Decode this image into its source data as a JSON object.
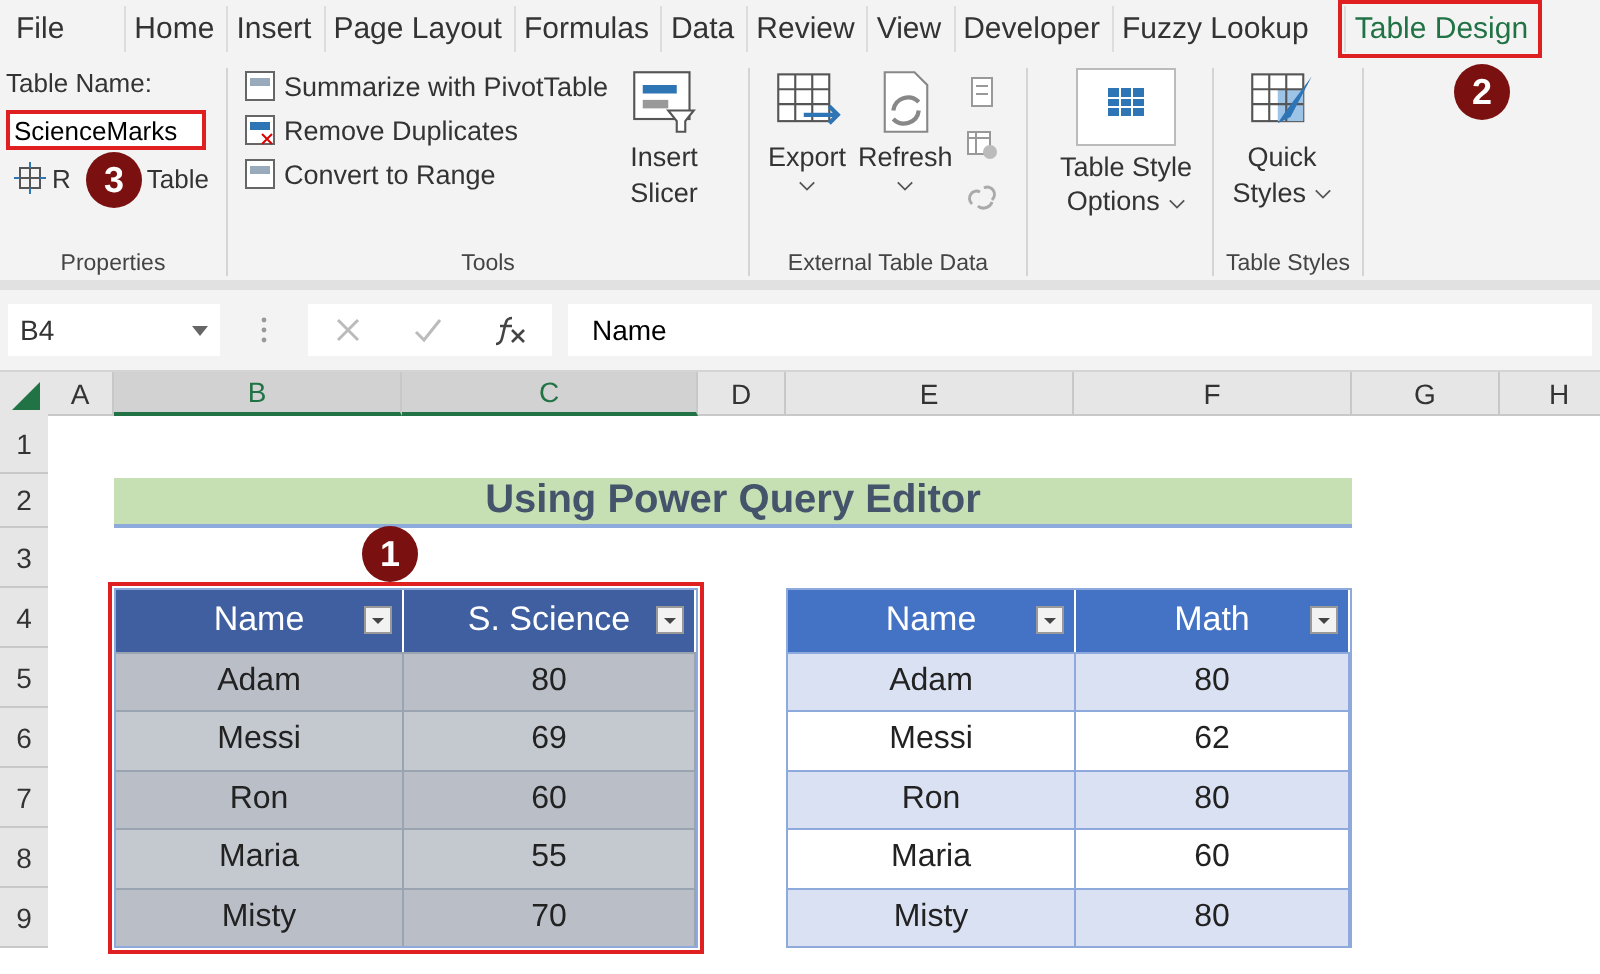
{
  "ribbon_tabs": [
    {
      "label": "File",
      "selected": false
    },
    {
      "label": "Home",
      "selected": false
    },
    {
      "label": "Insert",
      "selected": false
    },
    {
      "label": "Page Layout",
      "selected": false
    },
    {
      "label": "Formulas",
      "selected": false
    },
    {
      "label": "Data",
      "selected": false
    },
    {
      "label": "Review",
      "selected": false
    },
    {
      "label": "View",
      "selected": false
    },
    {
      "label": "Developer",
      "selected": false
    },
    {
      "label": "Fuzzy Lookup",
      "selected": false
    },
    {
      "label": "Table Design",
      "selected": true
    }
  ],
  "properties": {
    "name_label": "Table Name:",
    "name_value": "ScienceMarks",
    "resize_parts": [
      "R",
      "Table"
    ],
    "group_label": "Properties"
  },
  "tools": {
    "buttons": [
      "Summarize with PivotTable",
      "Remove Duplicates",
      "Convert to Range"
    ],
    "slicer": "Insert Slicer",
    "group_label": "Tools"
  },
  "external": {
    "buttons": [
      "Export",
      "Refresh"
    ],
    "group_label": "External Table Data"
  },
  "style_options": {
    "label": "Table Style Options"
  },
  "styles": {
    "label": "Quick Styles",
    "group_label": "Table Styles"
  },
  "callouts": [
    {
      "number": "1"
    },
    {
      "number": "2"
    },
    {
      "number": "3"
    }
  ],
  "name_box": "B4",
  "formula": "Name",
  "columns": [
    {
      "label": "A",
      "selected": false
    },
    {
      "label": "B",
      "selected": true
    },
    {
      "label": "C",
      "selected": true
    },
    {
      "label": "D",
      "selected": false
    },
    {
      "label": "E",
      "selected": false
    },
    {
      "label": "F",
      "selected": false
    },
    {
      "label": "G",
      "selected": false
    },
    {
      "label": "H",
      "selected": false
    }
  ],
  "rows": [
    "1",
    "2",
    "3",
    "4",
    "5",
    "6",
    "7",
    "8",
    "9"
  ],
  "title": "Using Power Query Editor",
  "tables": [
    {
      "selected": true,
      "columns": [
        "Name",
        "S. Science"
      ],
      "rows": [
        [
          "Adam",
          "80"
        ],
        [
          "Messi",
          "69"
        ],
        [
          "Ron",
          "60"
        ],
        [
          "Maria",
          "55"
        ],
        [
          "Misty",
          "70"
        ]
      ]
    },
    {
      "selected": false,
      "columns": [
        "Name",
        "Math"
      ],
      "rows": [
        [
          "Adam",
          "80"
        ],
        [
          "Messi",
          "62"
        ],
        [
          "Ron",
          "80"
        ],
        [
          "Maria",
          "60"
        ],
        [
          "Misty",
          "80"
        ]
      ]
    }
  ]
}
